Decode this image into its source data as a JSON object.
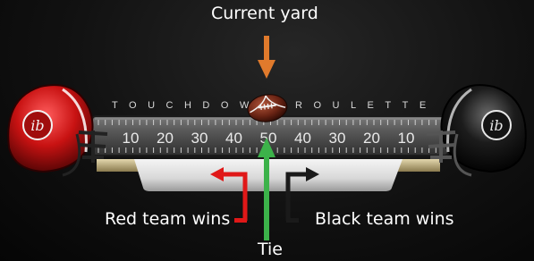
{
  "annotations": {
    "current_yard": "Current yard",
    "red_wins": "Red team wins",
    "black_wins": "Black team wins",
    "tie": "Tie"
  },
  "board": {
    "title_left": "TOUCHDOW",
    "title_right": "ROULETTE",
    "yard_numbers": [
      "10",
      "20",
      "30",
      "40",
      "50",
      "40",
      "30",
      "20",
      "10"
    ],
    "current_yard": 50
  },
  "helmets": {
    "left": {
      "team": "Red",
      "logo": "ib"
    },
    "right": {
      "team": "Black",
      "logo": "ib"
    }
  },
  "colors": {
    "red": "#e01818",
    "black": "#111111",
    "tie_arrow": "#3cb24a",
    "current_arrow": "#e07a2c",
    "gold": "#c9b98a"
  },
  "icons": [
    "football-icon",
    "red-helmet-icon",
    "black-helmet-icon"
  ]
}
